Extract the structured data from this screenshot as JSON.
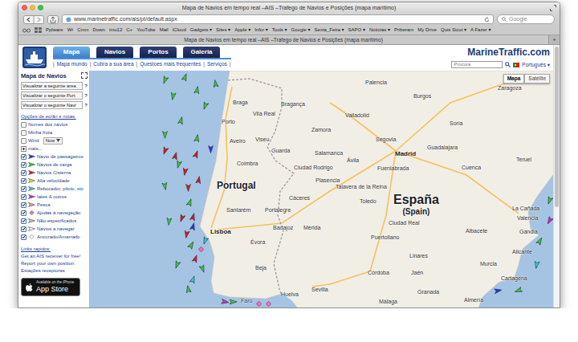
{
  "window": {
    "title": "Mapa de Navios em tempo real –AIS –Trafego de Navios e Posições (mapa marítimo)"
  },
  "toolbar": {
    "url": "www.marinetraffic.com/ais/pt/default.aspx",
    "search_placeholder": "Google"
  },
  "bookmarks": [
    "Pplware",
    "Wr",
    "Cmm",
    "Down",
    "imu12",
    "C+",
    "YouTube",
    "Mail",
    "iCloud",
    "Gadgets ▾",
    "Sites ▾",
    "Apple ▾",
    "Infor ▾",
    "Tools ▾",
    "Google ▾",
    "Sexta_Feira ▾",
    "SAPO ▾",
    "Noticias ▾",
    "Priberam",
    "My Drive",
    "Quis Sicut ▾",
    "A Fazer ▾"
  ],
  "tabs": [
    {
      "label": "Mapa de Navios em tempo real –AIS –Trafego de Navios e Posições (mapa marítimo)",
      "selected": true
    }
  ],
  "new_tab": "+",
  "site": {
    "nav_tabs": [
      {
        "label": "Mapa",
        "selected": true
      },
      {
        "label": "Navios",
        "selected": false
      },
      {
        "label": "Portos",
        "selected": false
      },
      {
        "label": "Galeria",
        "selected": false
      }
    ],
    "separator": "|",
    "subnav": [
      "Mapa mundo",
      "Cubra a sua área",
      "Questoes mais frequentes",
      "Serviços"
    ],
    "brand": "MarineTraffic.com",
    "search_placeholder": "Procura",
    "language": "Português ▾"
  },
  "sidebar": {
    "title": "Mapa de Navios",
    "selects": [
      {
        "label": "Visualizar a seguinte area",
        "help": "?"
      },
      {
        "label": "Visualizar o seguinte Port",
        "help": "?"
      },
      {
        "label": "Visualizar o seguinte Navi",
        "help": "?"
      }
    ],
    "options_title": "Opções de ecrãn e notas:",
    "options": [
      {
        "label": "Nomes dos navios",
        "checked": false,
        "kind": "checkbox"
      },
      {
        "label": "Minha frota",
        "checked": false,
        "kind": "checkbox"
      },
      {
        "label": "Wind",
        "checked": false,
        "kind": "select",
        "value": "Now"
      }
    ],
    "more": {
      "label": "mais...",
      "expanded": false
    },
    "legend": [
      {
        "label": "Navio de passageiros",
        "checked": true,
        "color": "#2233ee",
        "kind": "arrow"
      },
      {
        "label": "Navios de carga",
        "checked": true,
        "color": "#2fd12f",
        "kind": "arrow"
      },
      {
        "label": "Navios Cisterna",
        "checked": true,
        "color": "#e0141e",
        "kind": "arrow"
      },
      {
        "label": "Alta velocidade",
        "checked": true,
        "color": "#f2e31a",
        "kind": "arrow"
      },
      {
        "label": "Rebocador, piloto, etc",
        "checked": true,
        "color": "#1fd6e6",
        "kind": "arrow"
      },
      {
        "label": "Iates & outros",
        "checked": true,
        "color": "#e020e0",
        "kind": "arrow"
      },
      {
        "label": "Pesca",
        "checked": true,
        "color": "#f4a28a",
        "kind": "arrow"
      },
      {
        "label": "Ajudas à navegação",
        "checked": true,
        "color": "#f06fb8",
        "kind": "diamond"
      },
      {
        "label": "Não-especificados",
        "checked": true,
        "color": "#c8c8c8",
        "kind": "arrow"
      },
      {
        "label": "Navios a navegar",
        "checked": true,
        "color": "#ffffff",
        "kind": "arrow"
      },
      {
        "label": "Ancorado/Amarrado",
        "checked": true,
        "color": "#ffffff",
        "kind": "diamond"
      }
    ],
    "links_title": "Links rapidos:",
    "links": [
      "Get an AIS receiver for free!",
      "Report your own position",
      "Estações receptoras"
    ],
    "app_badge": {
      "small": "Available on the iPhone",
      "big": "App Store"
    }
  },
  "map": {
    "buttons": [
      {
        "label": "Mapa",
        "selected": true
      },
      {
        "label": "Satélite",
        "selected": false
      }
    ],
    "countries": [
      {
        "name": "Portugal",
        "note": ""
      },
      {
        "name": "España",
        "note": "(Spain)"
      }
    ],
    "cities": [
      {
        "name": "Palencia",
        "kind": "city"
      },
      {
        "name": "Zaragoza",
        "kind": "city"
      },
      {
        "name": "Burgos",
        "kind": "city"
      },
      {
        "name": "Braga",
        "kind": "city"
      },
      {
        "name": "Bragança",
        "kind": "city"
      },
      {
        "name": "Vila Real",
        "kind": "city"
      },
      {
        "name": "Valladolid",
        "kind": "city"
      },
      {
        "name": "Porto",
        "kind": "city"
      },
      {
        "name": "Soria",
        "kind": "city"
      },
      {
        "name": "Zamora",
        "kind": "city"
      },
      {
        "name": "Segovia",
        "kind": "city"
      },
      {
        "name": "Viseu",
        "kind": "city"
      },
      {
        "name": "Aveiro",
        "kind": "city"
      },
      {
        "name": "Guadalajara",
        "kind": "city"
      },
      {
        "name": "Guarda",
        "kind": "city"
      },
      {
        "name": "Salamanca",
        "kind": "city"
      },
      {
        "name": "Madrid",
        "kind": "capital"
      },
      {
        "name": "Teruel",
        "kind": "city"
      },
      {
        "name": "Ávila",
        "kind": "city"
      },
      {
        "name": "Coimbra",
        "kind": "city"
      },
      {
        "name": "Ciudad Rodrigo",
        "kind": "city"
      },
      {
        "name": "Fuenlabrada",
        "kind": "city"
      },
      {
        "name": "Cuenca",
        "kind": "city"
      },
      {
        "name": "Plasencia",
        "kind": "city"
      },
      {
        "name": "Talavera de la Reina",
        "kind": "city"
      },
      {
        "name": "Cáceres",
        "kind": "city"
      },
      {
        "name": "Toledo",
        "kind": "city"
      },
      {
        "name": "Santarém",
        "kind": "city"
      },
      {
        "name": "Portalegre",
        "kind": "city"
      },
      {
        "name": "La Cañada",
        "kind": "city"
      },
      {
        "name": "Valencia",
        "kind": "city"
      },
      {
        "name": "Ciudad Real",
        "kind": "city"
      },
      {
        "name": "Badajoz",
        "kind": "city"
      },
      {
        "name": "Mérida",
        "kind": "city"
      },
      {
        "name": "Albacete",
        "kind": "city"
      },
      {
        "name": "Lisboa",
        "kind": "capital"
      },
      {
        "name": "Gandia",
        "kind": "city"
      },
      {
        "name": "Puertollano",
        "kind": "city"
      },
      {
        "name": "Évora",
        "kind": "city"
      },
      {
        "name": "Alicante",
        "kind": "city"
      },
      {
        "name": "Linares",
        "kind": "city"
      },
      {
        "name": "Murcia",
        "kind": "city"
      },
      {
        "name": "Beja",
        "kind": "city"
      },
      {
        "name": "Córdoba",
        "kind": "city"
      },
      {
        "name": "Jaén",
        "kind": "city"
      },
      {
        "name": "Cartagena",
        "kind": "city"
      },
      {
        "name": "Sevilla",
        "kind": "city"
      },
      {
        "name": "Granada",
        "kind": "city"
      },
      {
        "name": "Huelva",
        "kind": "city"
      },
      {
        "name": "Faro",
        "kind": "city"
      },
      {
        "name": "Almería",
        "kind": "city"
      },
      {
        "name": "Málaga",
        "kind": "city"
      }
    ],
    "ships": [
      {
        "color": "#2fd12f",
        "kind": "moving"
      },
      {
        "color": "#2fd12f",
        "kind": "moving"
      },
      {
        "color": "#2fd12f",
        "kind": "moving"
      },
      {
        "color": "#2fd12f",
        "kind": "moving"
      },
      {
        "color": "#2fd12f",
        "kind": "moving"
      },
      {
        "color": "#2fd12f",
        "kind": "moving"
      },
      {
        "color": "#2fd12f",
        "kind": "moving"
      },
      {
        "color": "#2fd12f",
        "kind": "moving"
      },
      {
        "color": "#2fd12f",
        "kind": "moving"
      },
      {
        "color": "#2fd12f",
        "kind": "moving"
      },
      {
        "color": "#2fd12f",
        "kind": "moving"
      },
      {
        "color": "#2fd12f",
        "kind": "moving"
      },
      {
        "color": "#2fd12f",
        "kind": "moving"
      },
      {
        "color": "#2fd12f",
        "kind": "moving"
      },
      {
        "color": "#2fd12f",
        "kind": "moving"
      },
      {
        "color": "#2fd12f",
        "kind": "moving"
      },
      {
        "color": "#2fd12f",
        "kind": "moving"
      },
      {
        "color": "#2fd12f",
        "kind": "moving"
      },
      {
        "color": "#2fd12f",
        "kind": "moving"
      },
      {
        "color": "#2fd12f",
        "kind": "moving"
      },
      {
        "color": "#2fd12f",
        "kind": "moving"
      },
      {
        "color": "#e0141e",
        "kind": "moving"
      },
      {
        "color": "#e0141e",
        "kind": "moving"
      },
      {
        "color": "#e0141e",
        "kind": "moving"
      },
      {
        "color": "#e0141e",
        "kind": "moving"
      },
      {
        "color": "#e0141e",
        "kind": "moving"
      },
      {
        "color": "#e0141e",
        "kind": "moving"
      },
      {
        "color": "#e0141e",
        "kind": "moving"
      },
      {
        "color": "#e0141e",
        "kind": "moving"
      },
      {
        "color": "#e0141e",
        "kind": "moving"
      },
      {
        "color": "#e0141e",
        "kind": "moving"
      },
      {
        "color": "#2233ee",
        "kind": "moving"
      },
      {
        "color": "#2233ee",
        "kind": "moving"
      },
      {
        "color": "#2233ee",
        "kind": "moving"
      },
      {
        "color": "#e020e0",
        "kind": "moving"
      },
      {
        "color": "#e020e0",
        "kind": "moving"
      },
      {
        "color": "#1fd6e6",
        "kind": "moving"
      },
      {
        "color": "#1fd6e6",
        "kind": "moving"
      },
      {
        "color": "#1fd6e6",
        "kind": "moving"
      },
      {
        "color": "#f06fb8",
        "kind": "anchored"
      },
      {
        "color": "#f06fb8",
        "kind": "anchored"
      },
      {
        "color": "#f06fb8",
        "kind": "anchored"
      }
    ]
  }
}
